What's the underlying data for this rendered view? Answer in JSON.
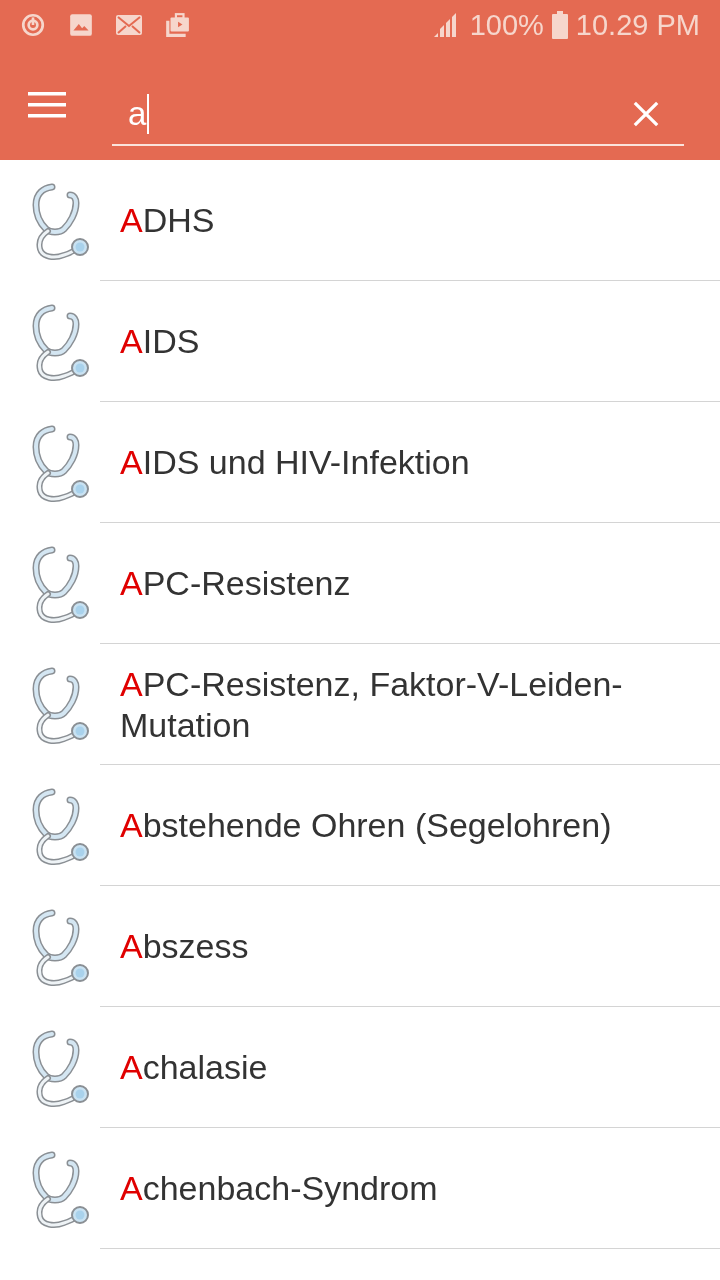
{
  "status_bar": {
    "battery": "100%",
    "time": "10.29 PM"
  },
  "search": {
    "value": "a"
  },
  "results": [
    {
      "highlight": "A",
      "rest": "DHS"
    },
    {
      "highlight": "A",
      "rest": "IDS"
    },
    {
      "highlight": "A",
      "rest": "IDS und HIV-Infektion"
    },
    {
      "highlight": "A",
      "rest": "PC-Resistenz"
    },
    {
      "highlight": "A",
      "rest": "PC-Resistenz, Faktor-V-Leiden-Mutation"
    },
    {
      "highlight": "A",
      "rest": "bstehende Ohren (Segelohren)"
    },
    {
      "highlight": "A",
      "rest": "bszess"
    },
    {
      "highlight": "A",
      "rest": "chalasie"
    },
    {
      "highlight": "A",
      "rest": "chenbach-Syndrom"
    }
  ]
}
